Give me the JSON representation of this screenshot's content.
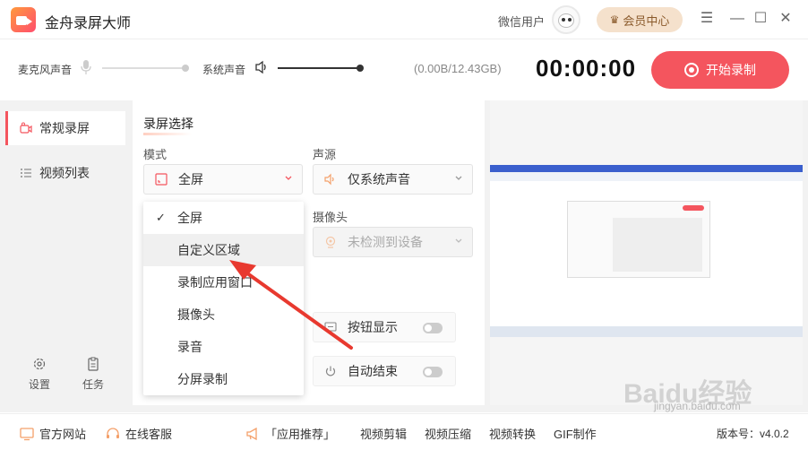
{
  "titlebar": {
    "app_title": "金舟录屏大师",
    "user_name": "微信用户",
    "vip_label": "会员中心"
  },
  "toolbar": {
    "mic_label": "麦克风声音",
    "sys_label": "系统声音",
    "storage": "(0.00B/12.43GB)",
    "timer": "00:00:00",
    "record_label": "开始录制"
  },
  "sidebar": {
    "items": [
      {
        "label": "常规录屏",
        "icon": "camera-icon",
        "active": true
      },
      {
        "label": "视频列表",
        "icon": "list-icon",
        "active": false
      }
    ],
    "settings_label": "设置",
    "tasks_label": "任务"
  },
  "panel": {
    "section_title": "录屏选择",
    "mode_label": "模式",
    "mode_value": "全屏",
    "audio_label": "声源",
    "audio_value": "仅系统声音",
    "camera_label": "摄像头",
    "camera_value": "未检测到设备",
    "toggle_button_label": "按钮显示",
    "toggle_auto_end_label": "自动结束"
  },
  "dropdown": {
    "items": [
      {
        "label": "全屏",
        "selected": true
      },
      {
        "label": "自定义区域",
        "hover": true
      },
      {
        "label": "录制应用窗口"
      },
      {
        "label": "摄像头"
      },
      {
        "label": "录音"
      },
      {
        "label": "分屏录制"
      }
    ]
  },
  "footer": {
    "website": "官方网站",
    "support": "在线客服",
    "recommend": "「应用推荐」",
    "edit": "视频剪辑",
    "compress": "视频压缩",
    "convert": "视频转换",
    "gif": "GIF制作",
    "version": "版本号：v4.0.2"
  },
  "watermark": {
    "logo": "Baidu经验",
    "url": "jingyan.baidu.com"
  },
  "colors": {
    "accent": "#f4555e",
    "vip_bg": "#f5e1cc",
    "arrow": "#e8392f"
  }
}
